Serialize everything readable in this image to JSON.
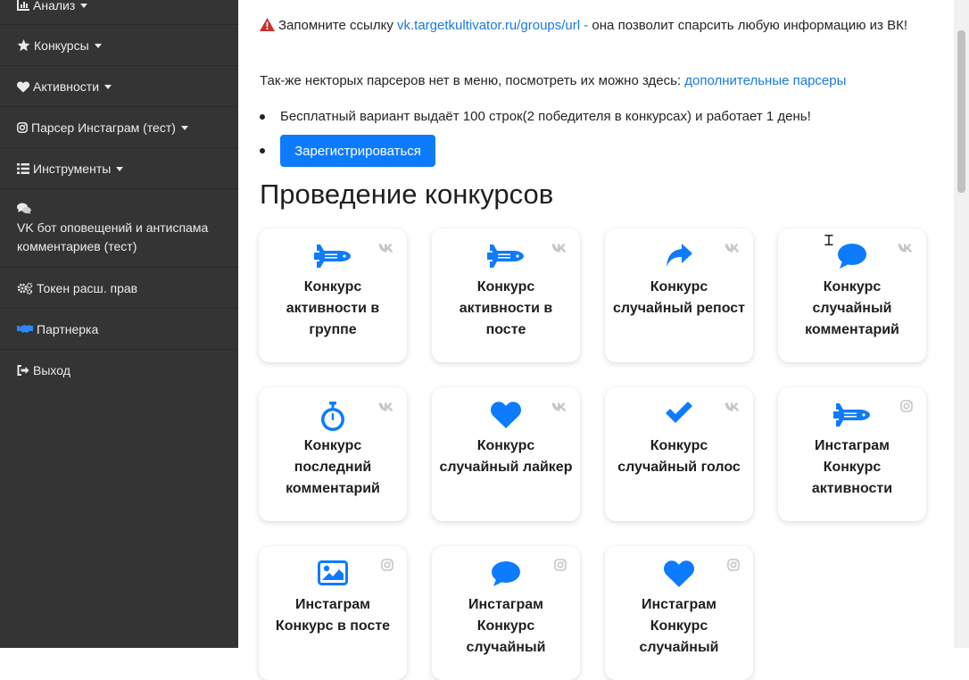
{
  "sidebar": {
    "items": [
      {
        "label": "Анализ",
        "icon": "bar-chart-icon",
        "dropdown": true
      },
      {
        "label": "Конкурсы",
        "icon": "star-icon",
        "dropdown": true
      },
      {
        "label": "Активности",
        "icon": "heart-icon",
        "dropdown": true
      },
      {
        "label": "Парсер Инстаграм (тест)",
        "icon": "instagram-icon",
        "dropdown": true
      },
      {
        "label": "Инструменты",
        "icon": "list-icon",
        "dropdown": true
      },
      {
        "label": "VK бот оповещений и антиспама комментариев (тест)",
        "icon": "comments-icon",
        "dropdown": false
      },
      {
        "label": "Токен расш. прав",
        "icon": "cogs-icon",
        "dropdown": false
      },
      {
        "label": "Партнерка",
        "icon": "handshake-icon",
        "dropdown": false
      },
      {
        "label": "Выход",
        "icon": "sign-out-icon",
        "dropdown": false
      }
    ]
  },
  "main": {
    "notice": {
      "prefix": "Запомните ссылку ",
      "link": "vk.targetkultivator.ru/groups/url",
      "suffix": " - она позволит спарсить любую информацию из ВК!"
    },
    "extra": {
      "text": "Так-же некторых парсеров нет в меню, посмотреть их можно здесь: ",
      "link": "дополнительные парсеры"
    },
    "free_text": "Бесплатный вариант выдаёт 100 строк(2 победителя в конкурсах) и работает 1 день!",
    "register_button": "Зарегистрироваться",
    "section_title": "Проведение конкурсов",
    "cards": [
      {
        "title": "Конкурс активности в группе",
        "icon": "space-shuttle-icon",
        "platform": "vk"
      },
      {
        "title": "Конкурс активности в посте",
        "icon": "space-shuttle-icon",
        "platform": "vk"
      },
      {
        "title": "Конкурс случайный репост",
        "icon": "share-icon",
        "platform": "vk"
      },
      {
        "title": "Конкурс случайный комментарий",
        "icon": "comment-icon",
        "platform": "vk"
      },
      {
        "title": "Конкурс последний комментарий",
        "icon": "stopwatch-icon",
        "platform": "vk"
      },
      {
        "title": "Конкурс случайный лайкер",
        "icon": "heart-icon",
        "platform": "vk"
      },
      {
        "title": "Конкурс случайный голос",
        "icon": "check-icon",
        "platform": "vk"
      },
      {
        "title": "Инстаграм Конкурс активности",
        "icon": "space-shuttle-icon",
        "platform": "instagram"
      },
      {
        "title": "Инстаграм Конкурс в посте",
        "icon": "image-icon",
        "platform": "instagram"
      },
      {
        "title": "Инстаграм Конкурс случайный",
        "icon": "comment-icon",
        "platform": "instagram"
      },
      {
        "title": "Инстаграм Конкурс случайный",
        "icon": "heart-icon",
        "platform": "instagram"
      }
    ]
  },
  "colors": {
    "sidebar_bg": "#343434",
    "accent": "#0d7bfd",
    "link": "#1a7ae0",
    "warning": "#c9302c"
  }
}
